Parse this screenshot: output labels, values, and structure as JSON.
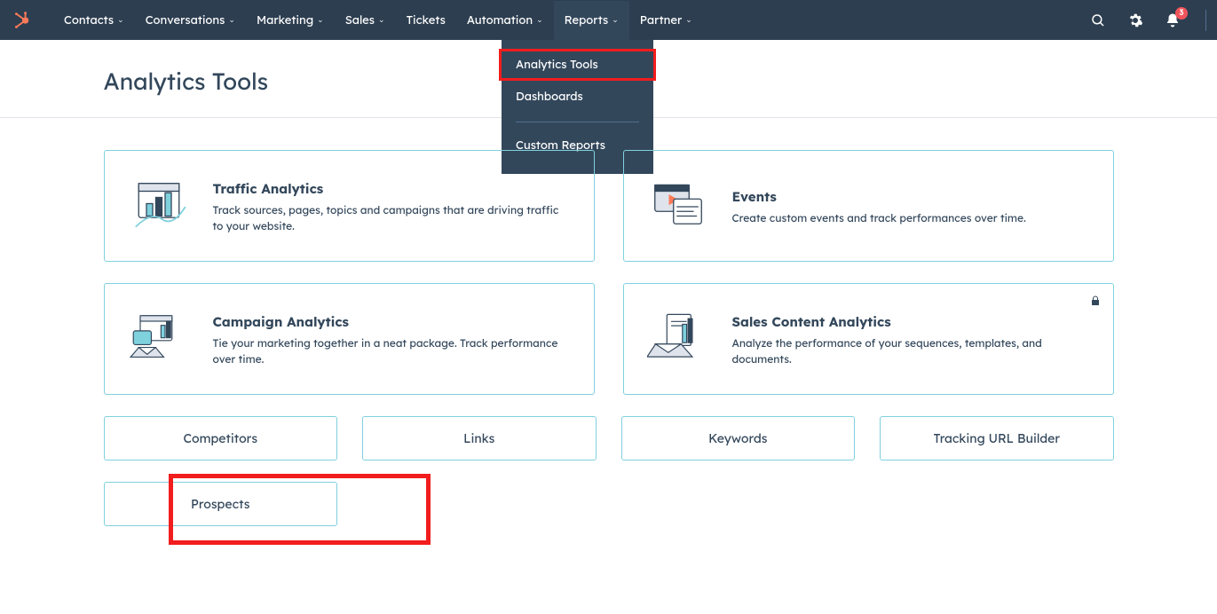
{
  "nav": {
    "items": [
      {
        "label": "Contacts"
      },
      {
        "label": "Conversations"
      },
      {
        "label": "Marketing"
      },
      {
        "label": "Sales"
      },
      {
        "label": "Tickets",
        "noChev": true
      },
      {
        "label": "Automation"
      },
      {
        "label": "Reports"
      },
      {
        "label": "Partner"
      }
    ],
    "dropdown": {
      "items": [
        {
          "label": "Analytics Tools"
        },
        {
          "label": "Dashboards"
        }
      ],
      "bottom": {
        "label": "Custom Reports"
      }
    }
  },
  "notifications": {
    "count": "3"
  },
  "page": {
    "title": "Analytics Tools"
  },
  "cards": [
    {
      "title": "Traffic Analytics",
      "desc": "Track sources, pages, topics and campaigns that are driving traffic to your website."
    },
    {
      "title": "Events",
      "desc": "Create custom events and track performances over time."
    },
    {
      "title": "Campaign Analytics",
      "desc": "Tie your marketing together in a neat package. Track performance over time."
    },
    {
      "title": "Sales Content Analytics",
      "desc": "Analyze the performance of your sequences, templates, and documents."
    }
  ],
  "tiles": {
    "row1": [
      "Competitors",
      "Links",
      "Keywords",
      "Tracking URL Builder"
    ],
    "row2": [
      "Prospects"
    ]
  }
}
